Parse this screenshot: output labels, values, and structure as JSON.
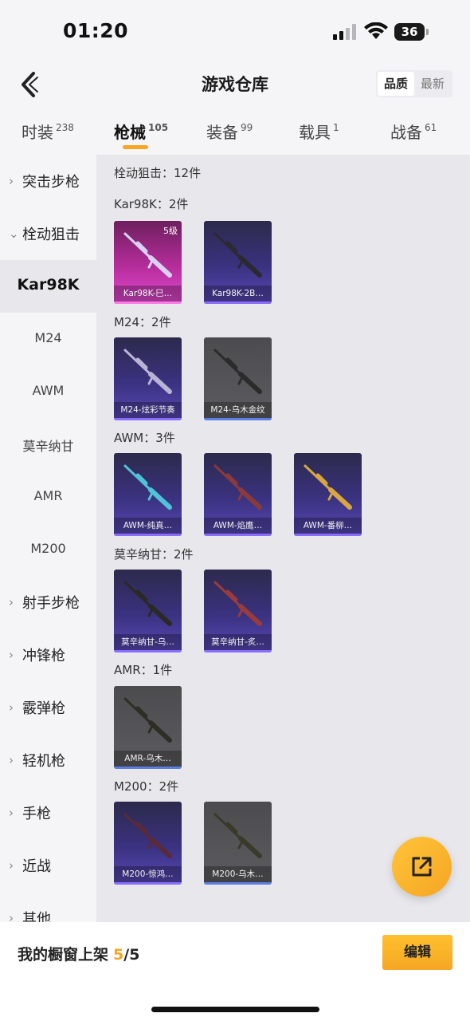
{
  "status_bar": {
    "time": "01:20",
    "battery": "36"
  },
  "header": {
    "title": "游戏仓库",
    "sort_options": [
      {
        "label": "品质",
        "active": true
      },
      {
        "label": "最新",
        "active": false
      }
    ]
  },
  "tabs": [
    {
      "label": "时装",
      "count": "238"
    },
    {
      "label": "枪械",
      "count": "105",
      "active": true
    },
    {
      "label": "装备",
      "count": "99"
    },
    {
      "label": "载具",
      "count": "1"
    },
    {
      "label": "战备",
      "count": "61"
    }
  ],
  "sidebar": {
    "items": [
      {
        "label": "突击步枪",
        "chevron": "›"
      },
      {
        "label": "栓动狙击",
        "chevron": "⌄"
      },
      {
        "label": "Kar98K",
        "selected": true
      },
      {
        "label": "M24"
      },
      {
        "label": "AWM"
      },
      {
        "label": "莫辛纳甘"
      },
      {
        "label": "AMR"
      },
      {
        "label": "M200"
      },
      {
        "label": "射手步枪",
        "chevron": "›"
      },
      {
        "label": "冲锋枪",
        "chevron": "›"
      },
      {
        "label": "霰弹枪",
        "chevron": "›"
      },
      {
        "label": "轻机枪",
        "chevron": "›"
      },
      {
        "label": "手枪",
        "chevron": "›"
      },
      {
        "label": "近战",
        "chevron": "›"
      },
      {
        "label": "其他",
        "chevron": "›"
      }
    ]
  },
  "content": {
    "summary": "栓动狙击：12件",
    "sections": [
      {
        "title": "Kar98K：2件",
        "items": [
          {
            "name": "Kar98K-巳…",
            "rarity": "pink",
            "level": "5级",
            "gun_color": "#d9d2f0"
          },
          {
            "name": "Kar98K-2B…",
            "rarity": "purple",
            "gun_color": "#2a2a30"
          }
        ]
      },
      {
        "title": "M24：2件",
        "items": [
          {
            "name": "M24-炫彩节奏",
            "rarity": "purple",
            "gun_color": "#b9b3d6"
          },
          {
            "name": "M24-乌木金纹",
            "rarity": "gray",
            "gun_color": "#2b2b2b"
          }
        ]
      },
      {
        "title": "AWM：3件",
        "items": [
          {
            "name": "AWM-纯真…",
            "rarity": "purple",
            "gun_color": "#4fc3d8"
          },
          {
            "name": "AWM-焰鹰…",
            "rarity": "purple",
            "gun_color": "#8a3a3a"
          },
          {
            "name": "AWM-番柳…",
            "rarity": "purple",
            "gun_color": "#d9a640"
          }
        ]
      },
      {
        "title": "莫辛纳甘：2件",
        "items": [
          {
            "name": "莫辛纳甘-乌…",
            "rarity": "purple",
            "gun_color": "#2a2a22"
          },
          {
            "name": "莫辛纳甘-炙…",
            "rarity": "purple",
            "gun_color": "#9c3b3b"
          }
        ]
      },
      {
        "title": "AMR：1件",
        "items": [
          {
            "name": "AMR-乌木…",
            "rarity": "gray",
            "gun_color": "#2e2e24"
          }
        ]
      },
      {
        "title": "M200：2件",
        "items": [
          {
            "name": "M200-惊鸿…",
            "rarity": "purple",
            "gun_color": "#5a2a3a"
          },
          {
            "name": "M200-乌木…",
            "rarity": "gray",
            "gun_color": "#3a3a2a"
          }
        ]
      }
    ]
  },
  "bottom_bar": {
    "showcase_label": "我的橱窗上架",
    "showcase_current": "5",
    "showcase_total": "/5",
    "edit_label": "编辑"
  },
  "colors": {
    "accent": "#f5a623",
    "rarity_purple": "#8a6cff",
    "rarity_pink": "#ff7be6",
    "rarity_gray": "#5b7de6"
  },
  "icons": {
    "back": "chevron-left-icon",
    "fab": "share-icon"
  }
}
